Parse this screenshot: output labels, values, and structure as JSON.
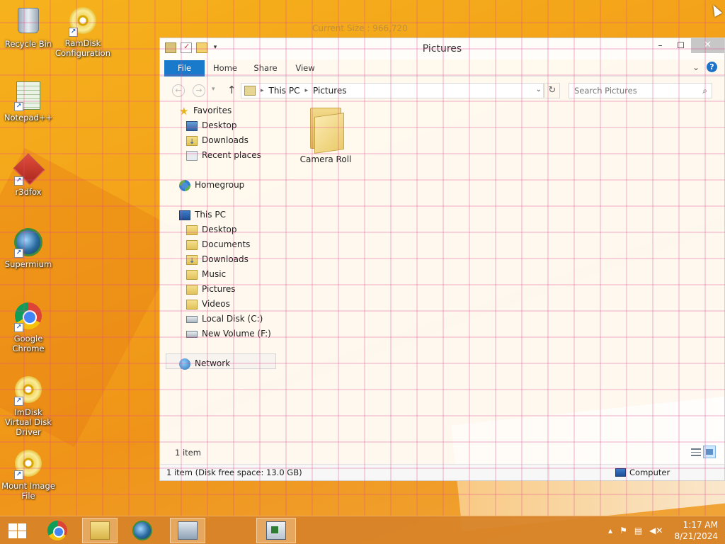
{
  "desktop": {
    "size_readout": "Current Size : 966,720",
    "icons": [
      {
        "label": "Recycle Bin"
      },
      {
        "label": "RamDisk Configuration"
      },
      {
        "label": "Notepad++"
      },
      {
        "label": "r3dfox"
      },
      {
        "label": "Supermium"
      },
      {
        "label": "Google Chrome"
      },
      {
        "label": "ImDisk Virtual Disk Driver"
      },
      {
        "label": "Mount Image File"
      }
    ]
  },
  "window": {
    "title": "Pictures",
    "controls": {
      "minimize": "–",
      "maximize": "☐",
      "close": "✕"
    },
    "ribbon": {
      "tabs": [
        "File",
        "Home",
        "Share",
        "View"
      ],
      "help": "?"
    },
    "address": {
      "crumbs": [
        "This PC",
        "Pictures"
      ],
      "search_placeholder": "Search Pictures"
    },
    "nav": {
      "favorites": "Favorites",
      "fav_items": [
        "Desktop",
        "Downloads",
        "Recent places"
      ],
      "homegroup": "Homegroup",
      "this_pc": "This PC",
      "pc_items": [
        "Desktop",
        "Documents",
        "Downloads",
        "Music",
        "Pictures",
        "Videos",
        "Local Disk (C:)",
        "New Volume (F:)"
      ],
      "network": "Network"
    },
    "content": {
      "items": [
        {
          "name": "Camera Roll"
        }
      ],
      "count": "1 item"
    },
    "status": {
      "left": "1 item (Disk free space: 13.0 GB)",
      "right": "Computer"
    }
  },
  "taskbar": {
    "clock": {
      "time": "1:17 AM",
      "date": "8/21/2024"
    }
  },
  "colors": {
    "accent": "#1979ca",
    "desktop": "#f3a21a",
    "grid": "#e1468c"
  }
}
